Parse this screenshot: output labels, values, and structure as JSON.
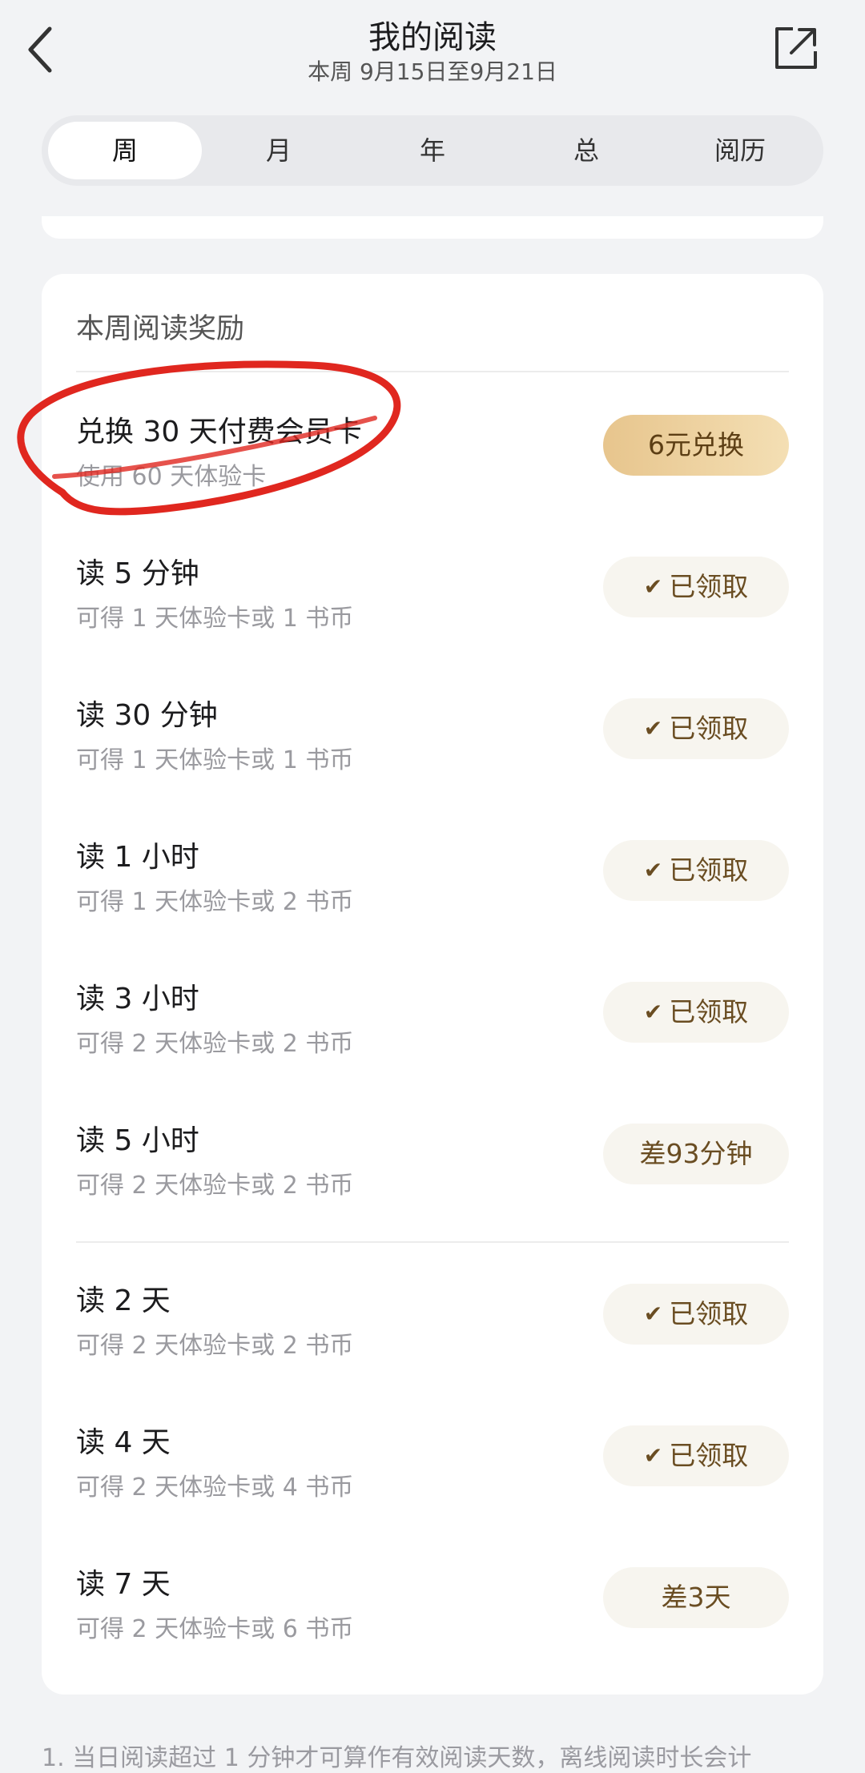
{
  "header": {
    "title": "我的阅读",
    "subtitle": "本周 9月15日至9月21日",
    "back_icon": "chevron-left-icon",
    "share_icon": "share-export-icon"
  },
  "tabs": [
    {
      "label": "周",
      "active": true
    },
    {
      "label": "月",
      "active": false
    },
    {
      "label": "年",
      "active": false
    },
    {
      "label": "总",
      "active": false
    },
    {
      "label": "阅历",
      "active": false
    }
  ],
  "rewards": {
    "title": "本周阅读奖励",
    "exchange": {
      "title": "兑换 30 天付费会员卡",
      "sub": "使用 60 天体验卡",
      "button": "6元兑换"
    },
    "time_items": [
      {
        "title": "读 5 分钟",
        "sub": "可得 1 天体验卡或 1 书币",
        "status": "已领取",
        "claimed": true
      },
      {
        "title": "读 30 分钟",
        "sub": "可得 1 天体验卡或 1 书币",
        "status": "已领取",
        "claimed": true
      },
      {
        "title": "读 1 小时",
        "sub": "可得 1 天体验卡或 2 书币",
        "status": "已领取",
        "claimed": true
      },
      {
        "title": "读 3 小时",
        "sub": "可得 2 天体验卡或 2 书币",
        "status": "已领取",
        "claimed": true
      },
      {
        "title": "读 5 小时",
        "sub": "可得 2 天体验卡或 2 书币",
        "status": "差93分钟",
        "claimed": false
      }
    ],
    "day_items": [
      {
        "title": "读 2 天",
        "sub": "可得 2 天体验卡或 2 书币",
        "status": "已领取",
        "claimed": true
      },
      {
        "title": "读 4 天",
        "sub": "可得 2 天体验卡或 4 书币",
        "status": "已领取",
        "claimed": true
      },
      {
        "title": "读 7 天",
        "sub": "可得 2 天体验卡或 6 书币",
        "status": "差3天",
        "claimed": false
      }
    ]
  },
  "footnote": "1. 当日阅读超过 1 分钟才可算作有效阅读天数，离线阅读时长会计",
  "colors": {
    "accent_gold": "#e7c58d",
    "annotation_red": "#e0271f"
  }
}
